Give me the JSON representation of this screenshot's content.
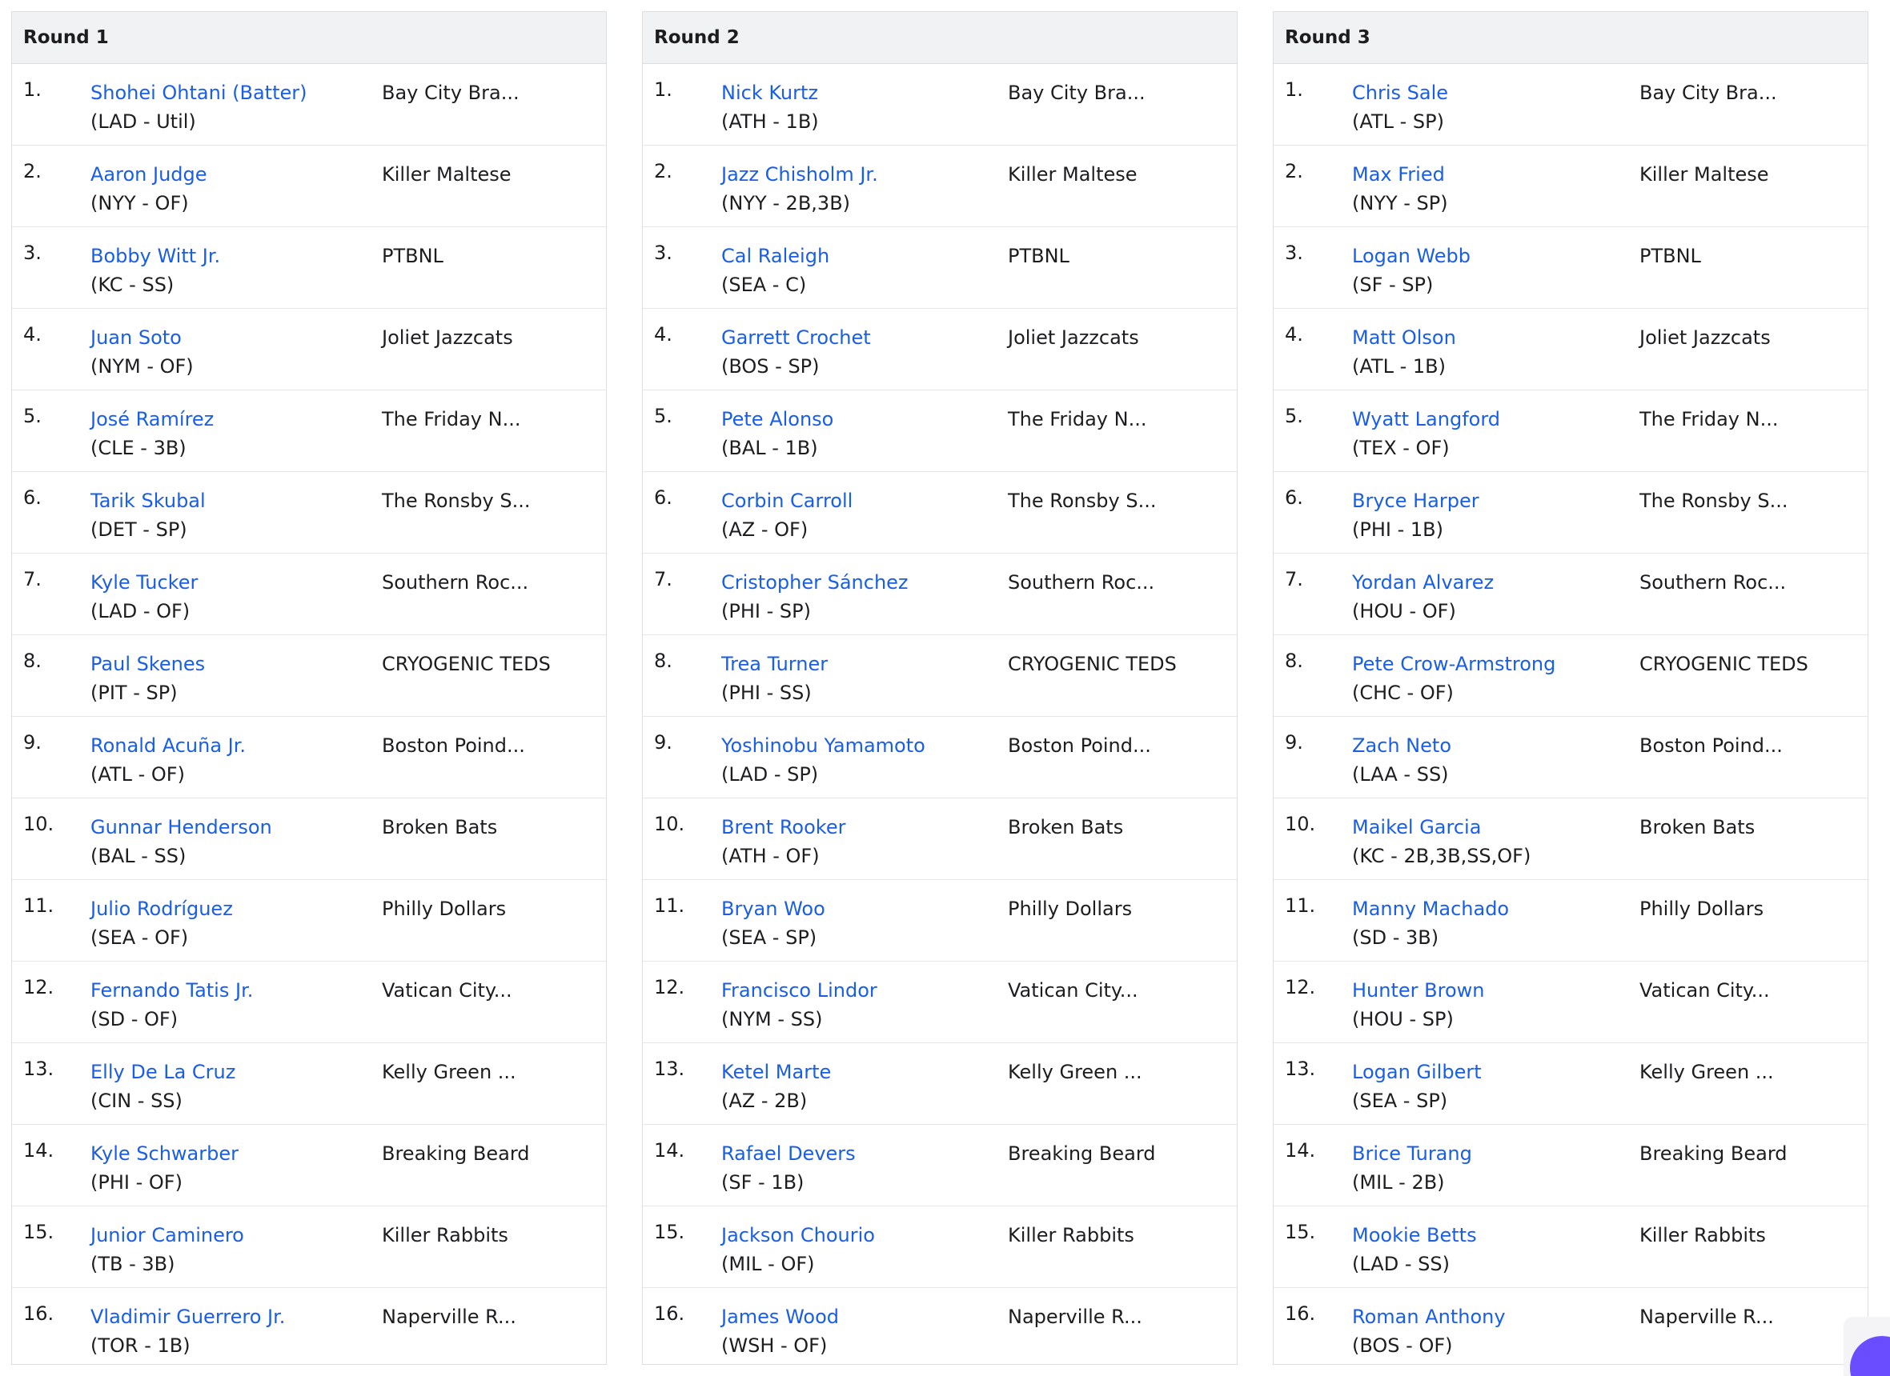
{
  "rounds": [
    {
      "title": "Round 1",
      "picks": [
        {
          "num": "1.",
          "player": "Shohei Ohtani (Batter)",
          "meta": "(LAD - Util)",
          "team": "Bay City Bra..."
        },
        {
          "num": "2.",
          "player": "Aaron Judge",
          "meta": "(NYY - OF)",
          "team": "Killer Maltese"
        },
        {
          "num": "3.",
          "player": "Bobby Witt Jr.",
          "meta": "(KC - SS)",
          "team": "PTBNL"
        },
        {
          "num": "4.",
          "player": "Juan Soto",
          "meta": "(NYM - OF)",
          "team": "Joliet Jazzcats"
        },
        {
          "num": "5.",
          "player": "José Ramírez",
          "meta": "(CLE - 3B)",
          "team": "The Friday N..."
        },
        {
          "num": "6.",
          "player": "Tarik Skubal",
          "meta": "(DET - SP)",
          "team": "The Ronsby S..."
        },
        {
          "num": "7.",
          "player": "Kyle Tucker",
          "meta": "(LAD - OF)",
          "team": "Southern Roc..."
        },
        {
          "num": "8.",
          "player": "Paul Skenes",
          "meta": "(PIT - SP)",
          "team": "CRYOGENIC TEDS"
        },
        {
          "num": "9.",
          "player": "Ronald Acuña Jr.",
          "meta": "(ATL - OF)",
          "team": "Boston Poind..."
        },
        {
          "num": "10.",
          "player": "Gunnar Henderson",
          "meta": "(BAL - SS)",
          "team": "Broken Bats"
        },
        {
          "num": "11.",
          "player": "Julio Rodríguez",
          "meta": "(SEA - OF)",
          "team": "Philly Dollars"
        },
        {
          "num": "12.",
          "player": "Fernando Tatis Jr.",
          "meta": "(SD - OF)",
          "team": "Vatican City..."
        },
        {
          "num": "13.",
          "player": "Elly De La Cruz",
          "meta": "(CIN - SS)",
          "team": "Kelly Green ..."
        },
        {
          "num": "14.",
          "player": "Kyle Schwarber",
          "meta": "(PHI - OF)",
          "team": "Breaking Beard"
        },
        {
          "num": "15.",
          "player": "Junior Caminero",
          "meta": "(TB - 3B)",
          "team": "Killer Rabbits"
        },
        {
          "num": "16.",
          "player": "Vladimir Guerrero Jr.",
          "meta": "(TOR - 1B)",
          "team": "Naperville R..."
        }
      ]
    },
    {
      "title": "Round 2",
      "picks": [
        {
          "num": "1.",
          "player": "Nick Kurtz",
          "meta": "(ATH - 1B)",
          "team": "Bay City Bra..."
        },
        {
          "num": "2.",
          "player": "Jazz Chisholm Jr.",
          "meta": "(NYY - 2B,3B)",
          "team": "Killer Maltese"
        },
        {
          "num": "3.",
          "player": "Cal Raleigh",
          "meta": "(SEA - C)",
          "team": "PTBNL"
        },
        {
          "num": "4.",
          "player": "Garrett Crochet",
          "meta": "(BOS - SP)",
          "team": "Joliet Jazzcats"
        },
        {
          "num": "5.",
          "player": "Pete Alonso",
          "meta": "(BAL - 1B)",
          "team": "The Friday N..."
        },
        {
          "num": "6.",
          "player": "Corbin Carroll",
          "meta": "(AZ - OF)",
          "team": "The Ronsby S..."
        },
        {
          "num": "7.",
          "player": "Cristopher Sánchez",
          "meta": "(PHI - SP)",
          "team": "Southern Roc..."
        },
        {
          "num": "8.",
          "player": "Trea Turner",
          "meta": "(PHI - SS)",
          "team": "CRYOGENIC TEDS"
        },
        {
          "num": "9.",
          "player": "Yoshinobu Yamamoto",
          "meta": "(LAD - SP)",
          "team": "Boston Poind..."
        },
        {
          "num": "10.",
          "player": "Brent Rooker",
          "meta": "(ATH - OF)",
          "team": "Broken Bats"
        },
        {
          "num": "11.",
          "player": "Bryan Woo",
          "meta": "(SEA - SP)",
          "team": "Philly Dollars"
        },
        {
          "num": "12.",
          "player": "Francisco Lindor",
          "meta": "(NYM - SS)",
          "team": "Vatican City..."
        },
        {
          "num": "13.",
          "player": "Ketel Marte",
          "meta": "(AZ - 2B)",
          "team": "Kelly Green ..."
        },
        {
          "num": "14.",
          "player": "Rafael Devers",
          "meta": "(SF - 1B)",
          "team": "Breaking Beard"
        },
        {
          "num": "15.",
          "player": "Jackson Chourio",
          "meta": "(MIL - OF)",
          "team": "Killer Rabbits"
        },
        {
          "num": "16.",
          "player": "James Wood",
          "meta": "(WSH - OF)",
          "team": "Naperville R..."
        }
      ]
    },
    {
      "title": "Round 3",
      "picks": [
        {
          "num": "1.",
          "player": "Chris Sale",
          "meta": "(ATL - SP)",
          "team": "Bay City Bra..."
        },
        {
          "num": "2.",
          "player": "Max Fried",
          "meta": "(NYY - SP)",
          "team": "Killer Maltese"
        },
        {
          "num": "3.",
          "player": "Logan Webb",
          "meta": "(SF - SP)",
          "team": "PTBNL"
        },
        {
          "num": "4.",
          "player": "Matt Olson",
          "meta": "(ATL - 1B)",
          "team": "Joliet Jazzcats"
        },
        {
          "num": "5.",
          "player": "Wyatt Langford",
          "meta": "(TEX - OF)",
          "team": "The Friday N..."
        },
        {
          "num": "6.",
          "player": "Bryce Harper",
          "meta": "(PHI - 1B)",
          "team": "The Ronsby S..."
        },
        {
          "num": "7.",
          "player": "Yordan Alvarez",
          "meta": "(HOU - OF)",
          "team": "Southern Roc..."
        },
        {
          "num": "8.",
          "player": "Pete Crow-Armstrong",
          "meta": "(CHC - OF)",
          "team": "CRYOGENIC TEDS"
        },
        {
          "num": "9.",
          "player": "Zach Neto",
          "meta": "(LAA - SS)",
          "team": "Boston Poind..."
        },
        {
          "num": "10.",
          "player": "Maikel Garcia",
          "meta": "(KC - 2B,3B,SS,OF)",
          "team": "Broken Bats"
        },
        {
          "num": "11.",
          "player": "Manny Machado",
          "meta": "(SD - 3B)",
          "team": "Philly Dollars"
        },
        {
          "num": "12.",
          "player": "Hunter Brown",
          "meta": "(HOU - SP)",
          "team": "Vatican City..."
        },
        {
          "num": "13.",
          "player": "Logan Gilbert",
          "meta": "(SEA - SP)",
          "team": "Kelly Green ..."
        },
        {
          "num": "14.",
          "player": "Brice Turang",
          "meta": "(MIL - 2B)",
          "team": "Breaking Beard"
        },
        {
          "num": "15.",
          "player": "Mookie Betts",
          "meta": "(LAD - SS)",
          "team": "Killer Rabbits"
        },
        {
          "num": "16.",
          "player": "Roman Anthony",
          "meta": "(BOS - OF)",
          "team": "Naperville R..."
        }
      ]
    }
  ],
  "colors": {
    "link": "#1a5ee6",
    "header_bg": "#f1f2f3",
    "widget_accent": "#6a4dff"
  }
}
